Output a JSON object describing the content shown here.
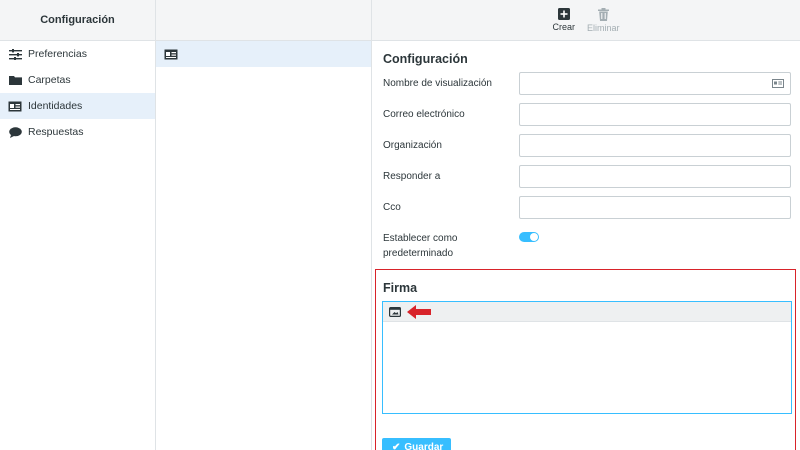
{
  "left": {
    "title": "Configuración",
    "items": [
      {
        "label": "Preferencias",
        "icon": "sliders-icon",
        "selected": false
      },
      {
        "label": "Carpetas",
        "icon": "folder-icon",
        "selected": false
      },
      {
        "label": "Identidades",
        "icon": "id-card-icon",
        "selected": true
      },
      {
        "label": "Respuestas",
        "icon": "comment-icon",
        "selected": false
      }
    ]
  },
  "middle": {
    "identities": [
      {
        "icon": "id-card-icon",
        "label": ""
      }
    ]
  },
  "toolbar": {
    "create_label": "Crear",
    "delete_label": "Eliminar",
    "delete_disabled": true
  },
  "form": {
    "title": "Configuración",
    "fields": [
      {
        "label": "Nombre de visualización",
        "value": ""
      },
      {
        "label": "Correo electrónico",
        "value": ""
      },
      {
        "label": "Organización",
        "value": ""
      },
      {
        "label": "Responder a",
        "value": ""
      },
      {
        "label": "Cco",
        "value": ""
      }
    ],
    "default_label": "Establecer como predeterminado",
    "default_enabled": true
  },
  "signature": {
    "title": "Firma",
    "editor_content": "",
    "save_label": "Guardar"
  },
  "colors": {
    "accent": "#37beff",
    "highlight_border": "#d8232a",
    "arrow": "#d8232a",
    "selected_bg": "#e6f0fa"
  }
}
